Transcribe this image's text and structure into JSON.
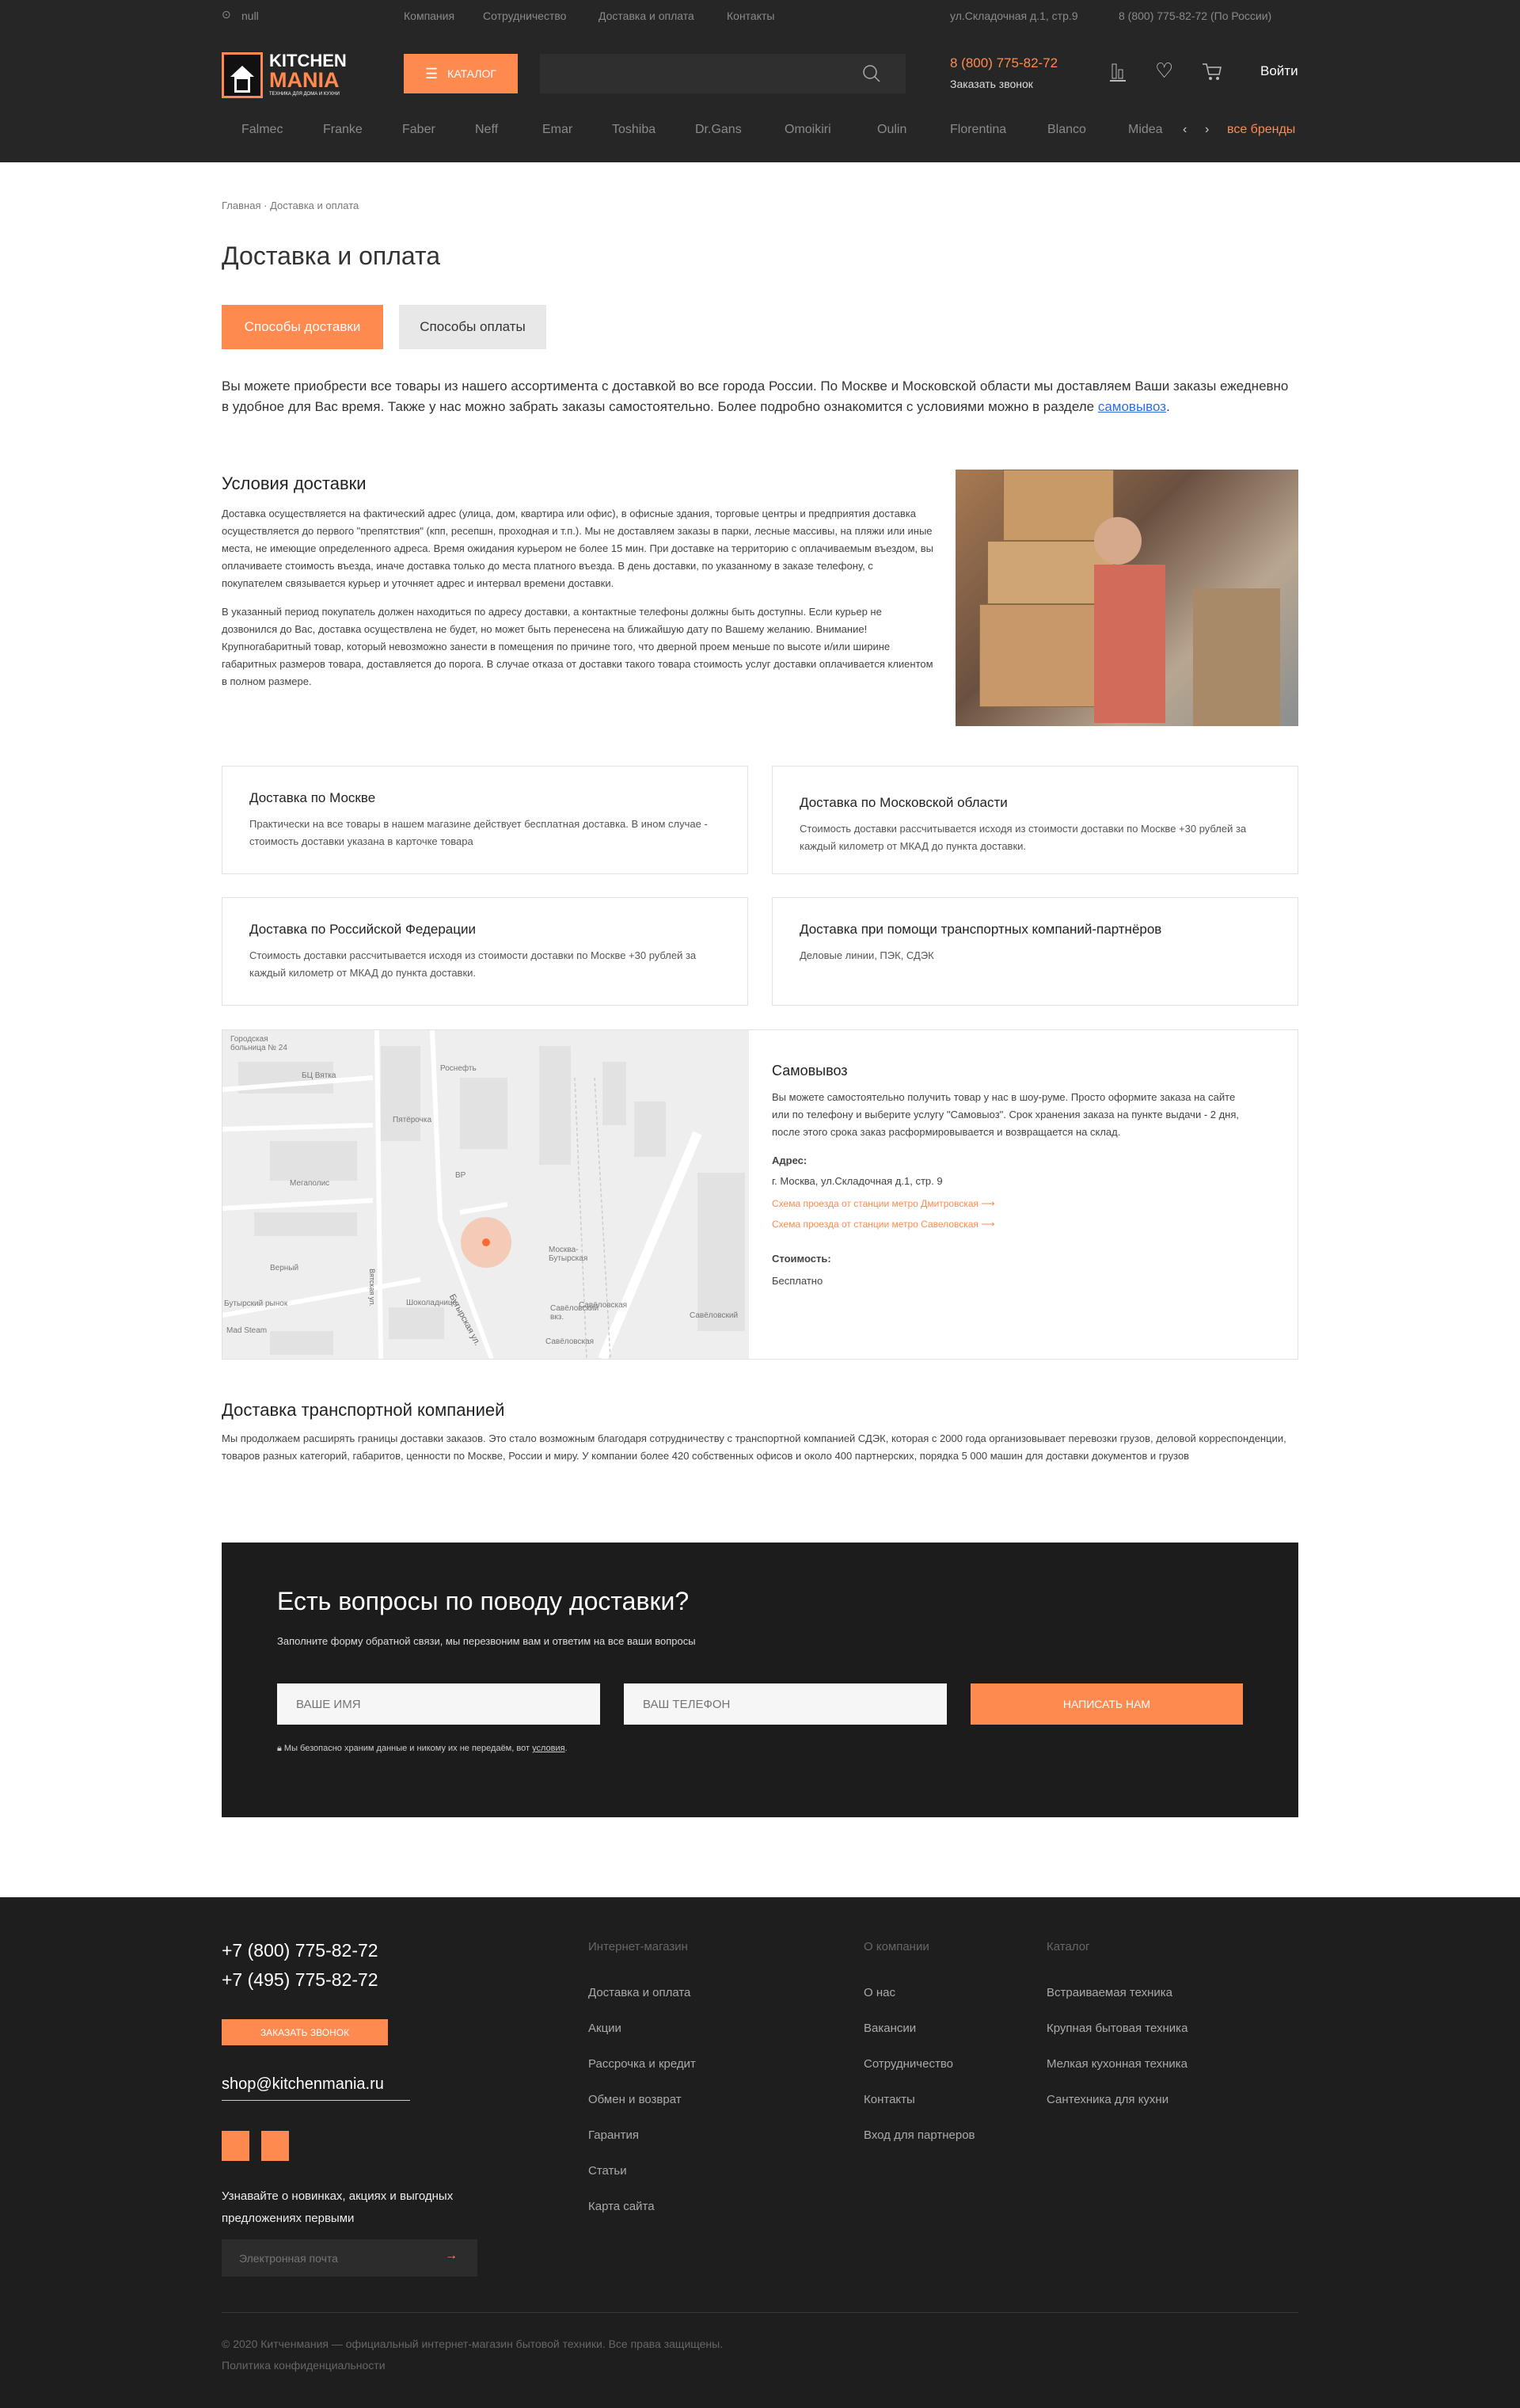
{
  "topbar": {
    "city": "null",
    "nav": [
      "Компания",
      "Сотрудничество",
      "Доставка и оплата",
      "Контакты"
    ],
    "address": "ул.Складочная д.1, стр.9",
    "phone": "8 (800) 775-82-72 (По России)"
  },
  "header": {
    "logo_line1": "KITCHEN",
    "logo_line2": "MANIA",
    "logo_tagline": "ТЕХНИКА ДЛЯ ДОМА И КУХНИ",
    "catalog": "КАТАЛОГ",
    "search_placeholder": "",
    "phone": "8 (800) 775-82-72",
    "callback": "Заказать звонок",
    "login": "Войти"
  },
  "brands": {
    "items": [
      "Falmec",
      "Franke",
      "Faber",
      "Neff",
      "Emar",
      "Toshiba",
      "Dr.Gans",
      "Omoikiri",
      "Oulin",
      "Florentina",
      "Blanco",
      "Midea"
    ],
    "prev": "‹",
    "next": "›",
    "all": "все бренды"
  },
  "breadcrumb": {
    "home": "Главная",
    "sep": "·",
    "current": "Доставка и оплата"
  },
  "page_title": "Доставка и оплата",
  "tabs": [
    "Способы доставки",
    "Способы оплаты"
  ],
  "intro": {
    "text": "Вы можете приобрести все товары из нашего ассортимента с доставкой во все города России. По Москве и Московской области мы доставляем Ваши заказы ежедневно в удобное для Вас время. Также у нас можно забрать заказы самостоятельно. Более подробно ознакомится с условиями можно в разделе ",
    "link": "самовывоз",
    "end": "."
  },
  "conditions": {
    "title": "Условия доставки",
    "p1": "Доставка осуществляется на фактический адрес (улица, дом, квартира или офис), в офисные здания, торговые центры и предприятия доставка осуществляется до первого \"препятствия\" (кпп, ресепшн, проходная и т.п.). Мы не доставляем заказы в парки, лесные массивы, на пляжи или иные места, не имеющие определенного адреса. Время ожидания курьером не более 15 мин. При доставке на территорию с оплачиваемым въездом, вы оплачиваете стоимость въезда, иначе доставка только до места платного въезда. В день доставки, по указанному в заказе телефону, с покупателем связывается курьер и уточняет адрес и интервал времени доставки.",
    "p2": "В указанный период покупатель должен находиться по адресу доставки, а контактные телефоны должны быть доступны. Если курьер не дозвонился до Вас, доставка осуществлена не будет, но может быть перенесена на ближайшую дату по Вашему желанию. Внимание! Крупногабаритный товар, который невозможно занести в помещения по причине того, что дверной проем меньше по высоте и/или ширине габаритных размеров товара, доставляется до порога. В случае отказа от доставки такого товара стоимость услуг доставки оплачивается клиентом в полном размере."
  },
  "cards": [
    {
      "title": "Доставка по Москве",
      "text": "Практически на все товары в нашем магазине действует бесплатная доставка. В ином случае - стоимость доставки указана в карточке товара"
    },
    {
      "title": "Доставка по Московской области",
      "text": "Стоимость доставки рассчитывается исходя из стоимости доставки по Москве +30 рублей за каждый километр от МКАД до пункта доставки."
    },
    {
      "title": "Доставка по Российской Федерации",
      "text": "Стоимость доставки рассчитывается исходя из стоимости доставки по Москве +30 рублей за каждый километр от МКАД до пункта доставки."
    },
    {
      "title": "Доставка при помощи транспортных компаний-партнёров",
      "text": "Деловые линии, ПЭК, СДЭК"
    }
  ],
  "pickup": {
    "title": "Самовывоз",
    "text": "Вы можете самостоятельно получить товар у нас в шоу-руме. Просто оформите заказа на сайте или по телефону и выберите услугу \"Самовыоз\". Срок хранения заказа на пункте выдачи - 2 дня, после этого срока заказ расформировывается и возвращается на склад.",
    "address_label": "Адрес:",
    "address": "г. Москва, ул.Складочная д.1, стр. 9",
    "link1": "Схема проезда от станции метро Дмитровская  ⟶",
    "link2": "Схема проезда от станции метро Савеловская  ⟶",
    "cost_label": "Стоимость:",
    "cost": "Бесплатно",
    "map_labels": [
      "Городская больница № 24",
      "БЦ Вятка",
      "Роснефть",
      "Пятёрочка",
      "Мегаполис",
      "BP",
      "Москва-Бутырская",
      "Савёловская",
      "Бутырская ул.",
      "Вятская ул.",
      "Верный",
      "Бутырский рынок",
      "Mad Steam",
      "Шоколадница",
      "Савёловский вкз.",
      "Савёловский",
      "Савёловская"
    ]
  },
  "transport": {
    "title": "Доставка транспортной компанией",
    "text": "Мы продолжаем расширять границы доставки заказов. Это стало возможным благодаря сотрудничеству с транспортной компанией СДЭК, которая с 2000 года организовывает перевозки грузов, деловой корреспонденции, товаров разных категорий, габаритов, ценности по Москве, России и миру. У компании более 420 собственных офисов и около 400 партнерских, порядка 5 000 машин для доставки документов и грузов"
  },
  "question_form": {
    "title": "Есть вопросы по поводу доставки?",
    "subtitle": "Заполните форму обратной связи, мы перезвоним вам и ответим на все ваши вопросы",
    "name_placeholder": "ВАШЕ ИМЯ",
    "phone_placeholder": "ВАШ ТЕЛЕФОН",
    "submit": "НАПИСАТЬ НАМ",
    "privacy": "Мы безопасно храним данные и никому их не передаём, вот ",
    "privacy_link": "условия",
    "privacy_end": "."
  },
  "footer": {
    "phone1": "+7 (800) 775-82-72",
    "phone2": "+7 (495) 775-82-72",
    "callback": "ЗАКАЗАТЬ ЗВОНОК",
    "email": "shop@kitchenmania.ru",
    "subscribe_text": "Узнавайте о новинках, акциях и выгодных предложениях первыми",
    "email_placeholder": "Электронная почта",
    "columns": [
      {
        "title": "Интернет-магазин",
        "links": [
          "Доставка и оплата",
          "Акции",
          "Рассрочка и кредит",
          "Обмен и возврат",
          "Гарантия",
          "Статьи",
          "Карта сайта"
        ]
      },
      {
        "title": "О компании",
        "links": [
          "О нас",
          "Вакансии",
          "Сотрудничество",
          "Контакты",
          "Вход для партнеров"
        ]
      },
      {
        "title": "Каталог",
        "links": [
          "Встраиваемая техника",
          "Крупная бытовая техника",
          "Мелкая кухонная техника",
          "Сантехника для кухни"
        ]
      }
    ],
    "copyright": "© 2020 Китченмания — официальный интернет-магазин бытовой техники. Все права защищены.",
    "privacy": "Политика конфиденциальности"
  },
  "colors": {
    "accent": "#ff8a50",
    "dark": "#262626",
    "link": "#2d6fe0"
  }
}
